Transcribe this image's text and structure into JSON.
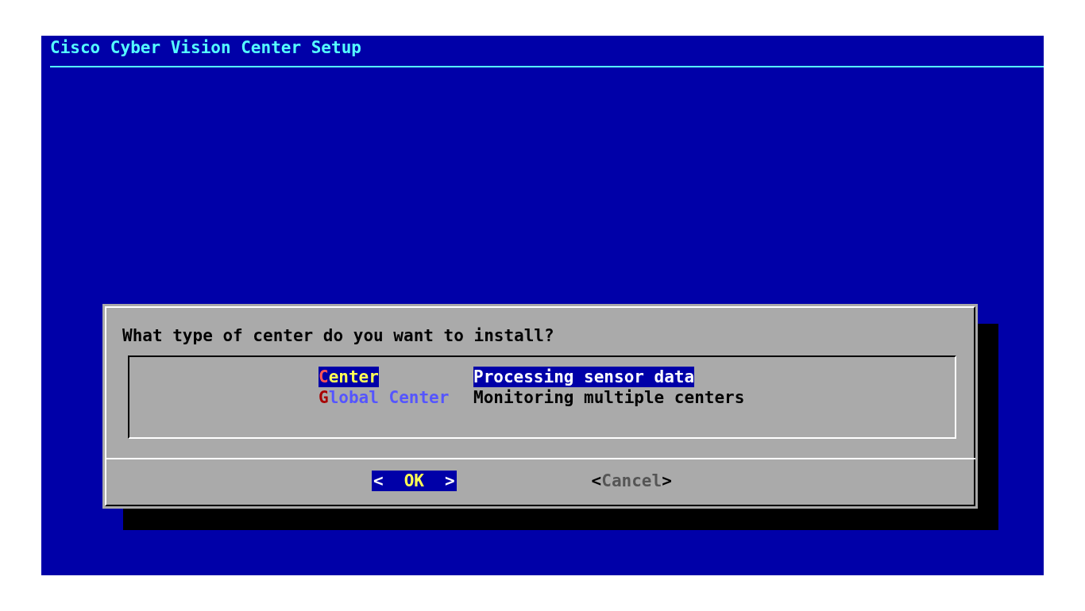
{
  "screen": {
    "title": "Cisco Cyber Vision Center Setup"
  },
  "dialog": {
    "prompt": "What type of center do you want to install?",
    "items": [
      {
        "tag": "Center",
        "description": "Processing sensor data",
        "selected": true
      },
      {
        "tag": "Global Center",
        "description": "Monitoring multiple centers",
        "selected": false
      }
    ],
    "buttons": [
      {
        "open": "<",
        "label": "OK",
        "close": ">",
        "selected": true
      },
      {
        "open": "<",
        "label": "Cancel",
        "close": ">",
        "selected": false
      }
    ]
  }
}
